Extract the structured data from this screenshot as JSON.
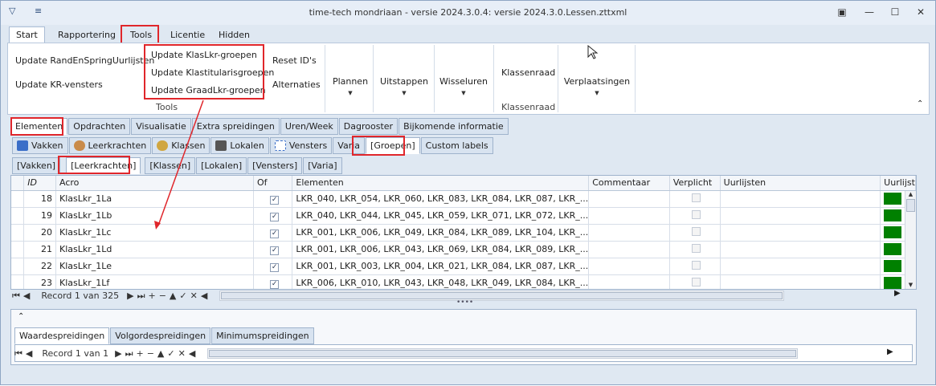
{
  "window": {
    "title": "time-tech mondriaan - versie 2024.3.0.4: versie 2024.3.0.Lessen.zttxml"
  },
  "ribbon_tabs": [
    "Start",
    "Rapportering",
    "Tools",
    "Licentie",
    "Hidden"
  ],
  "ribbon": {
    "update_randen": "Update RandEnSpringUurlijsten",
    "update_kr": "Update KR-vensters",
    "update_klaslkr": "Update KlasLkr-groepen",
    "update_klastit": "Update Klastitularisgroepen",
    "update_graadlkr": "Update GraadLkr-groepen",
    "tools_caption": "Tools",
    "reset_ids": "Reset ID's",
    "alternaties": "Alternaties",
    "plannen": "Plannen",
    "uitstappen": "Uitstappen",
    "wisseluren": "Wisseluren",
    "klassenraad_btn": "Klassenraad",
    "klassenraad_caption": "Klassenraad",
    "verplaatsingen": "Verplaatsingen"
  },
  "main_tabs": [
    "Elementen",
    "Opdrachten",
    "Visualisatie",
    "Extra spreidingen",
    "Uren/Week",
    "Dagrooster",
    "Bijkomende informatie"
  ],
  "sub_tabs": [
    "Vakken",
    "Leerkrachten",
    "Klassen",
    "Lokalen",
    "Vensters",
    "Varia",
    "[Groepen]",
    "Custom labels"
  ],
  "group_tabs": [
    "[Vakken]",
    "[Leerkrachten]",
    "[Klassen]",
    "[Lokalen]",
    "[Vensters]",
    "[Varia]"
  ],
  "grid": {
    "columns": [
      "ID",
      "Acro",
      "Of",
      "Elementen",
      "Commentaar",
      "Verplicht",
      "Uurlijsten",
      "Uurlijst"
    ],
    "rows": [
      {
        "id": "18",
        "acro": "KlasLkr_1La",
        "elementen": "LKR_040, LKR_054, LKR_060, LKR_083, LKR_084, LKR_087, LKR_..."
      },
      {
        "id": "19",
        "acro": "KlasLkr_1Lb",
        "elementen": "LKR_040, LKR_044, LKR_045, LKR_059, LKR_071, LKR_072, LKR_..."
      },
      {
        "id": "20",
        "acro": "KlasLkr_1Lc",
        "elementen": "LKR_001, LKR_006, LKR_049, LKR_084, LKR_089, LKR_104, LKR_..."
      },
      {
        "id": "21",
        "acro": "KlasLkr_1Ld",
        "elementen": "LKR_001, LKR_006, LKR_043, LKR_069, LKR_084, LKR_089, LKR_..."
      },
      {
        "id": "22",
        "acro": "KlasLkr_1Le",
        "elementen": "LKR_001, LKR_003, LKR_004, LKR_021, LKR_084, LKR_087, LKR_..."
      },
      {
        "id": "23",
        "acro": "KlasLkr_1Lf",
        "elementen": "LKR_006, LKR_010, LKR_043, LKR_048, LKR_049, LKR_084, LKR_..."
      }
    ],
    "record_text": "Record 1 van 325"
  },
  "bottom_tabs": [
    "Waardespreidingen",
    "Volgordespreidingen",
    "Minimumspreidingen"
  ],
  "bottom_record_text": "Record 1 van 1"
}
